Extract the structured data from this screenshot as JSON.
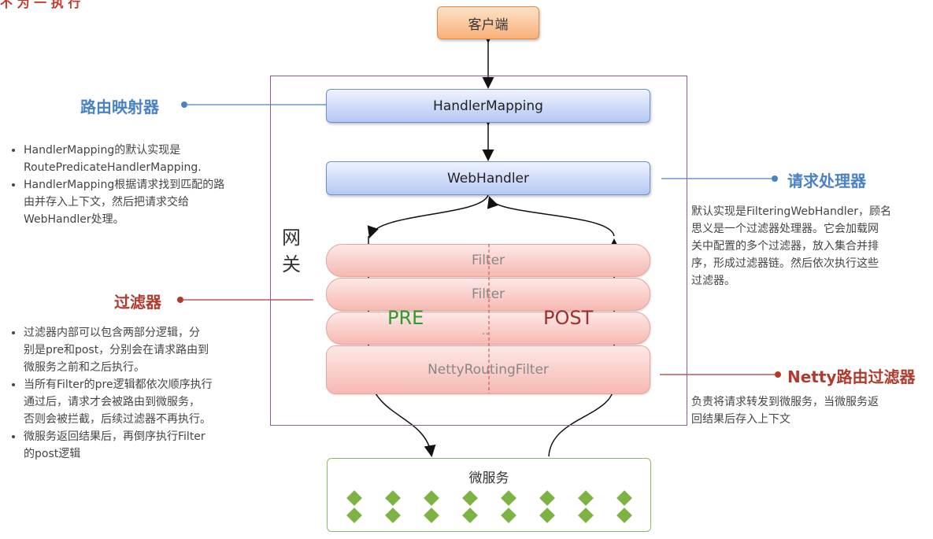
{
  "top_partial": "不 为 一 执 行",
  "client": "客户端",
  "gateway_label": [
    "网",
    "关"
  ],
  "handler_mapping": "HandlerMapping",
  "web_handler": "WebHandler",
  "filters": [
    "Filter",
    "Filter",
    "..",
    "NettyRoutingFilter"
  ],
  "pre": "PRE",
  "post": "POST",
  "microservice": "微服务",
  "routing_mapper": {
    "title": "路由映射器",
    "bullets": [
      [
        "HandlerMapping的默认实现是",
        "RoutePredicateHandlerMapping."
      ],
      [
        "HandlerMapping根据请求找到匹配的路",
        "由并存入上下文，然后把请求交给",
        "WebHandler处理。"
      ]
    ]
  },
  "request_handler": {
    "title": "请求处理器",
    "lines": [
      "默认实现是FilteringWebHandler，顾名",
      "思义是一个过滤器处理器。它会加载网",
      "关中配置的多个过滤器，放入集合并排",
      "序，形成过滤器链。然后依次执行这些",
      "过滤器。"
    ]
  },
  "filter_section": {
    "title": "过滤器",
    "bullets": [
      [
        "过滤器内部可以包含两部分逻辑，分",
        "别是pre和post，分别会在请求路由到",
        "微服务之前和之后执行。"
      ],
      [
        "当所有Filter的pre逻辑都依次顺序执行",
        "通过后，请求才会被路由到微服务，",
        "否则会被拦截，后续过滤器不再执行。"
      ],
      [
        "微服务返回结果后，再倒序执行Filter",
        "的post逻辑"
      ]
    ]
  },
  "netty_section": {
    "title": "Netty路由过滤器",
    "lines": [
      "负责将请求转发到微服务，当微服务返",
      "回结果后存入上下文"
    ]
  },
  "colors": {
    "blue_title": "#4a82c4",
    "red_title": "#b03a2e",
    "pre": "#2f9a2f",
    "post": "#a03030"
  }
}
